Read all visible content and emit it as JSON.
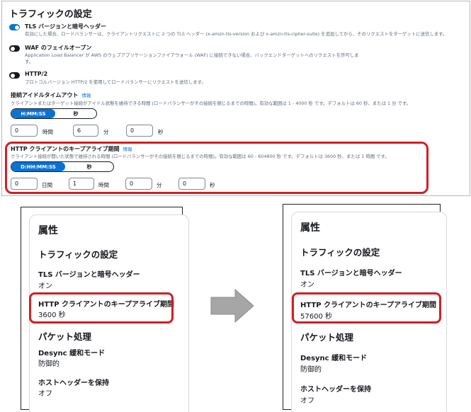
{
  "top": {
    "title": "トラフィックの設定",
    "tls": {
      "label": "TLS バージョンと暗号ヘッダー",
      "desc": "有効にした場合、ロードバランサーは、クライアントリクエストに 2 つの TLS ヘッダー (x-amzn-tls-version および x-amzn-tls-cipher-suite) を追加してから、そのリクエストをターゲットに送信します。",
      "state": "on"
    },
    "waf": {
      "label": "WAF のフェイルオープン",
      "desc1": "Application Load Balancer が AWS のウェブアプリケーションファイアウォール (WAF) に接続できない場合、バックエンドターゲットへのリクエストを許可しま",
      "desc2": "す。",
      "state": "off"
    },
    "http2": {
      "label": "HTTP/2",
      "desc": "プロトコルバージョン HTTP/2 を使用してロードバランサーにリクエストを送信します。",
      "state": "off"
    },
    "idle": {
      "label": "接続アイドルタイムアウト",
      "info": "情報",
      "desc": "クライアントまたはターゲット接続がアイドル状態を維持できる時間 (ロードバランサーがその接続を閉じるまでの時間)。有効な範囲は 1 - 4000 秒 です。デフォルトは 60 秒、または 1 分 です。",
      "seg_active": "H:MM:SS",
      "seg_other": "秒",
      "hours": "0",
      "hours_unit": "時間",
      "minutes": "6",
      "minutes_unit": "分",
      "seconds": "0",
      "seconds_unit": "秒"
    },
    "keepalive": {
      "label": "HTTP クライアントのキープアライブ期間",
      "info": "情報",
      "desc": "クライアント接続が開いた状態で維持される時間 (ロードバランサーがその接続を閉じるまでの時間)。有効な範囲は 60 - 604800 秒 です。デフォルトは 3600 秒、または 1 時間 です。",
      "seg_active": "D:HH:MM:SS",
      "seg_other": "秒",
      "days": "0",
      "days_unit": "日間",
      "hours": "1",
      "hours_unit": "時間",
      "minutes": "0",
      "minutes_unit": "分",
      "seconds": "0",
      "seconds_unit": "秒"
    }
  },
  "before": {
    "title": "属性",
    "section": "トラフィックの設定",
    "tls_key": "TLS バージョンと暗号ヘッダー",
    "tls_val": "オン",
    "keepalive_key": "HTTP クライアントのキープアライブ期間",
    "keepalive_val": "3600 秒",
    "packet_section": "パケット処理",
    "desync_key": "Desync 緩和モード",
    "desync_val": "防御的",
    "host_key": "ホストヘッダーを保持",
    "host_val": "オフ"
  },
  "after": {
    "title": "属性",
    "section": "トラフィックの設定",
    "tls_key": "TLS バージョンと暗号ヘッダー",
    "tls_val": "オン",
    "keepalive_key": "HTTP クライアントのキープアライブ期間",
    "keepalive_val": "57600 秒",
    "packet_section": "パケット処理",
    "desync_key": "Desync 緩和モード",
    "desync_val": "防御的",
    "host_key": "ホストヘッダーを保持",
    "host_val": "オフ"
  },
  "colors": {
    "accent": "#0972d3",
    "highlight": "#d21e25",
    "arrow": "#a6a6a6"
  },
  "icons": {
    "arrow": "right-arrow-icon"
  }
}
